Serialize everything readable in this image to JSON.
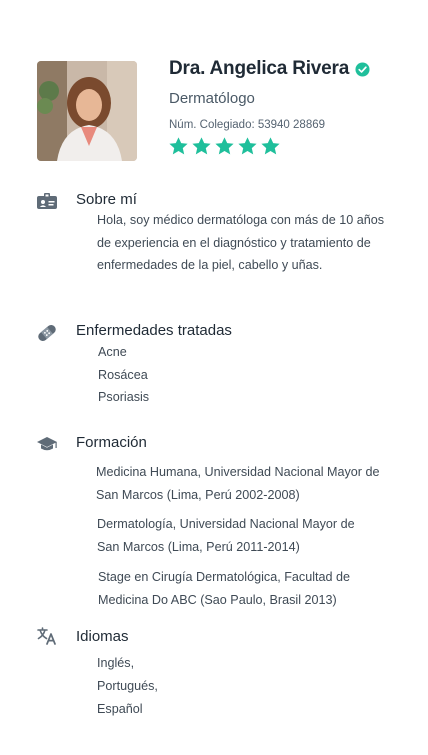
{
  "profile": {
    "name": "Dra. Angelica Rivera",
    "specialty": "Dermatólogo",
    "colegiado": "Núm. Colegiado: 53940 28869",
    "rating": 5,
    "rating_max": 5,
    "verified_icon": "verified-check-icon",
    "accent_color": "#1fbf9b"
  },
  "sobre": {
    "title": "Sobre mí",
    "icon": "id-card-icon",
    "text": "Hola, soy médico dermatóloga con más de 10 años de experiencia en el  diagnóstico y tratamiento de enfermedades de la piel, cabello y uñas."
  },
  "enfermedades": {
    "title": "Enfermedades tratadas",
    "icon": "bandage-icon",
    "items": [
      "Acne",
      "Rosácea",
      "Psoriasis"
    ]
  },
  "formacion": {
    "title": "Formación",
    "icon": "graduation-cap-icon",
    "items": [
      "Medicina Humana, Universidad Nacional Mayor de San Marcos (Lima, Perú 2002-2008)",
      "Dermatología, Universidad Nacional Mayor de San Marcos (Lima, Perú 2011-2014)",
      "Stage en Cirugía Dermatológica, Facultad de Medicina Do ABC (Sao Paulo, Brasil 2013)"
    ]
  },
  "idiomas": {
    "title": "Idiomas",
    "icon": "translate-icon",
    "items": [
      "Inglés,",
      "Portugués,",
      "Español"
    ]
  }
}
